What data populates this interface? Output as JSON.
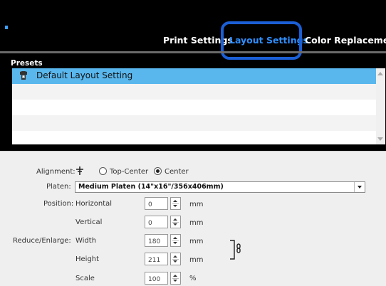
{
  "tabs": [
    {
      "label": "Print Settings"
    },
    {
      "label": "Layout Settings"
    },
    {
      "label": "Color Replacement"
    }
  ],
  "presets": {
    "title": "Presets",
    "items": [
      {
        "label": "Default Layout Setting",
        "selected": true
      }
    ]
  },
  "form": {
    "alignment": {
      "label": "Alignment:",
      "options": [
        "Top-Center",
        "Center"
      ],
      "selected": "Center"
    },
    "platen": {
      "label": "Platen:",
      "value": "Medium Platen (14\"x16\"/356x406mm)"
    },
    "position": {
      "label": "Position:",
      "horizontal_label": "Horizontal",
      "horizontal_value": "0",
      "vertical_label": "Vertical",
      "vertical_value": "0",
      "unit": "mm"
    },
    "reduce_enlarge": {
      "label": "Reduce/Enlarge:",
      "width_label": "Width",
      "width_value": "180",
      "height_label": "Height",
      "height_value": "211",
      "unit": "mm",
      "scale_label": "Scale",
      "scale_value": "100",
      "scale_unit": "%"
    }
  },
  "colors": {
    "accent": "#2f8fff",
    "highlight_border": "#1b5fd6",
    "selected_row": "#59b7ed"
  }
}
